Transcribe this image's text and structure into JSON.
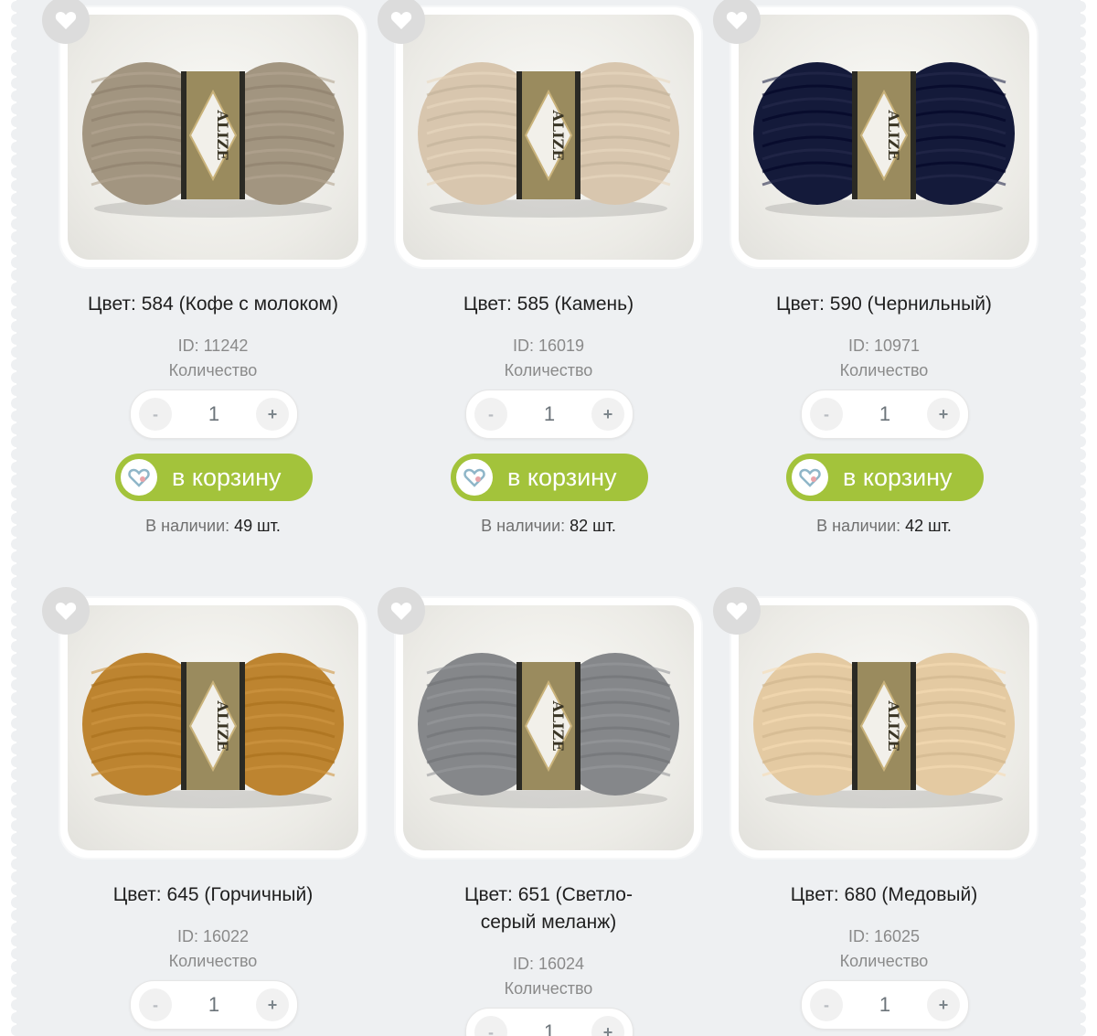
{
  "theme": {
    "accent": "#a3c33b",
    "panel": "#eef0f2"
  },
  "products": [
    {
      "title": "Цвет: 584 (Кофе с молоком)",
      "id": "ID: 11242",
      "qty_label": "Количество",
      "qty": "1",
      "minus": "-",
      "plus": "+",
      "cart": "в корзину",
      "stock_label": "В наличии:",
      "stock_value": "49 шт.",
      "yarn_color": "#a29580",
      "brand": "ALIZE"
    },
    {
      "title": "Цвет: 585 (Камень)",
      "id": "ID: 16019",
      "qty_label": "Количество",
      "qty": "1",
      "minus": "-",
      "plus": "+",
      "cart": "в корзину",
      "stock_label": "В наличии:",
      "stock_value": "82 шт.",
      "yarn_color": "#d8c6ae",
      "brand": "ALIZE"
    },
    {
      "title": "Цвет: 590 (Чернильный)",
      "id": "ID: 10971",
      "qty_label": "Количество",
      "qty": "1",
      "minus": "-",
      "plus": "+",
      "cart": "в корзину",
      "stock_label": "В наличии:",
      "stock_value": "42 шт.",
      "yarn_color": "#141a3a",
      "brand": "ALIZE"
    },
    {
      "title": "Цвет: 645 (Горчичный)",
      "id": "ID: 16022",
      "qty_label": "Количество",
      "qty": "1",
      "minus": "-",
      "plus": "+",
      "yarn_color": "#bd8430",
      "brand": "ALIZE"
    },
    {
      "title": "Цвет: 651 (Светло-серый меланж)",
      "id": "ID: 16024",
      "qty_label": "Количество",
      "qty": "1",
      "minus": "-",
      "plus": "+",
      "yarn_color": "#85878a",
      "brand": "ALIZE"
    },
    {
      "title": "Цвет: 680 (Медовый)",
      "id": "ID: 16025",
      "qty_label": "Количество",
      "qty": "1",
      "minus": "-",
      "plus": "+",
      "yarn_color": "#e4caa2",
      "brand": "ALIZE"
    }
  ]
}
